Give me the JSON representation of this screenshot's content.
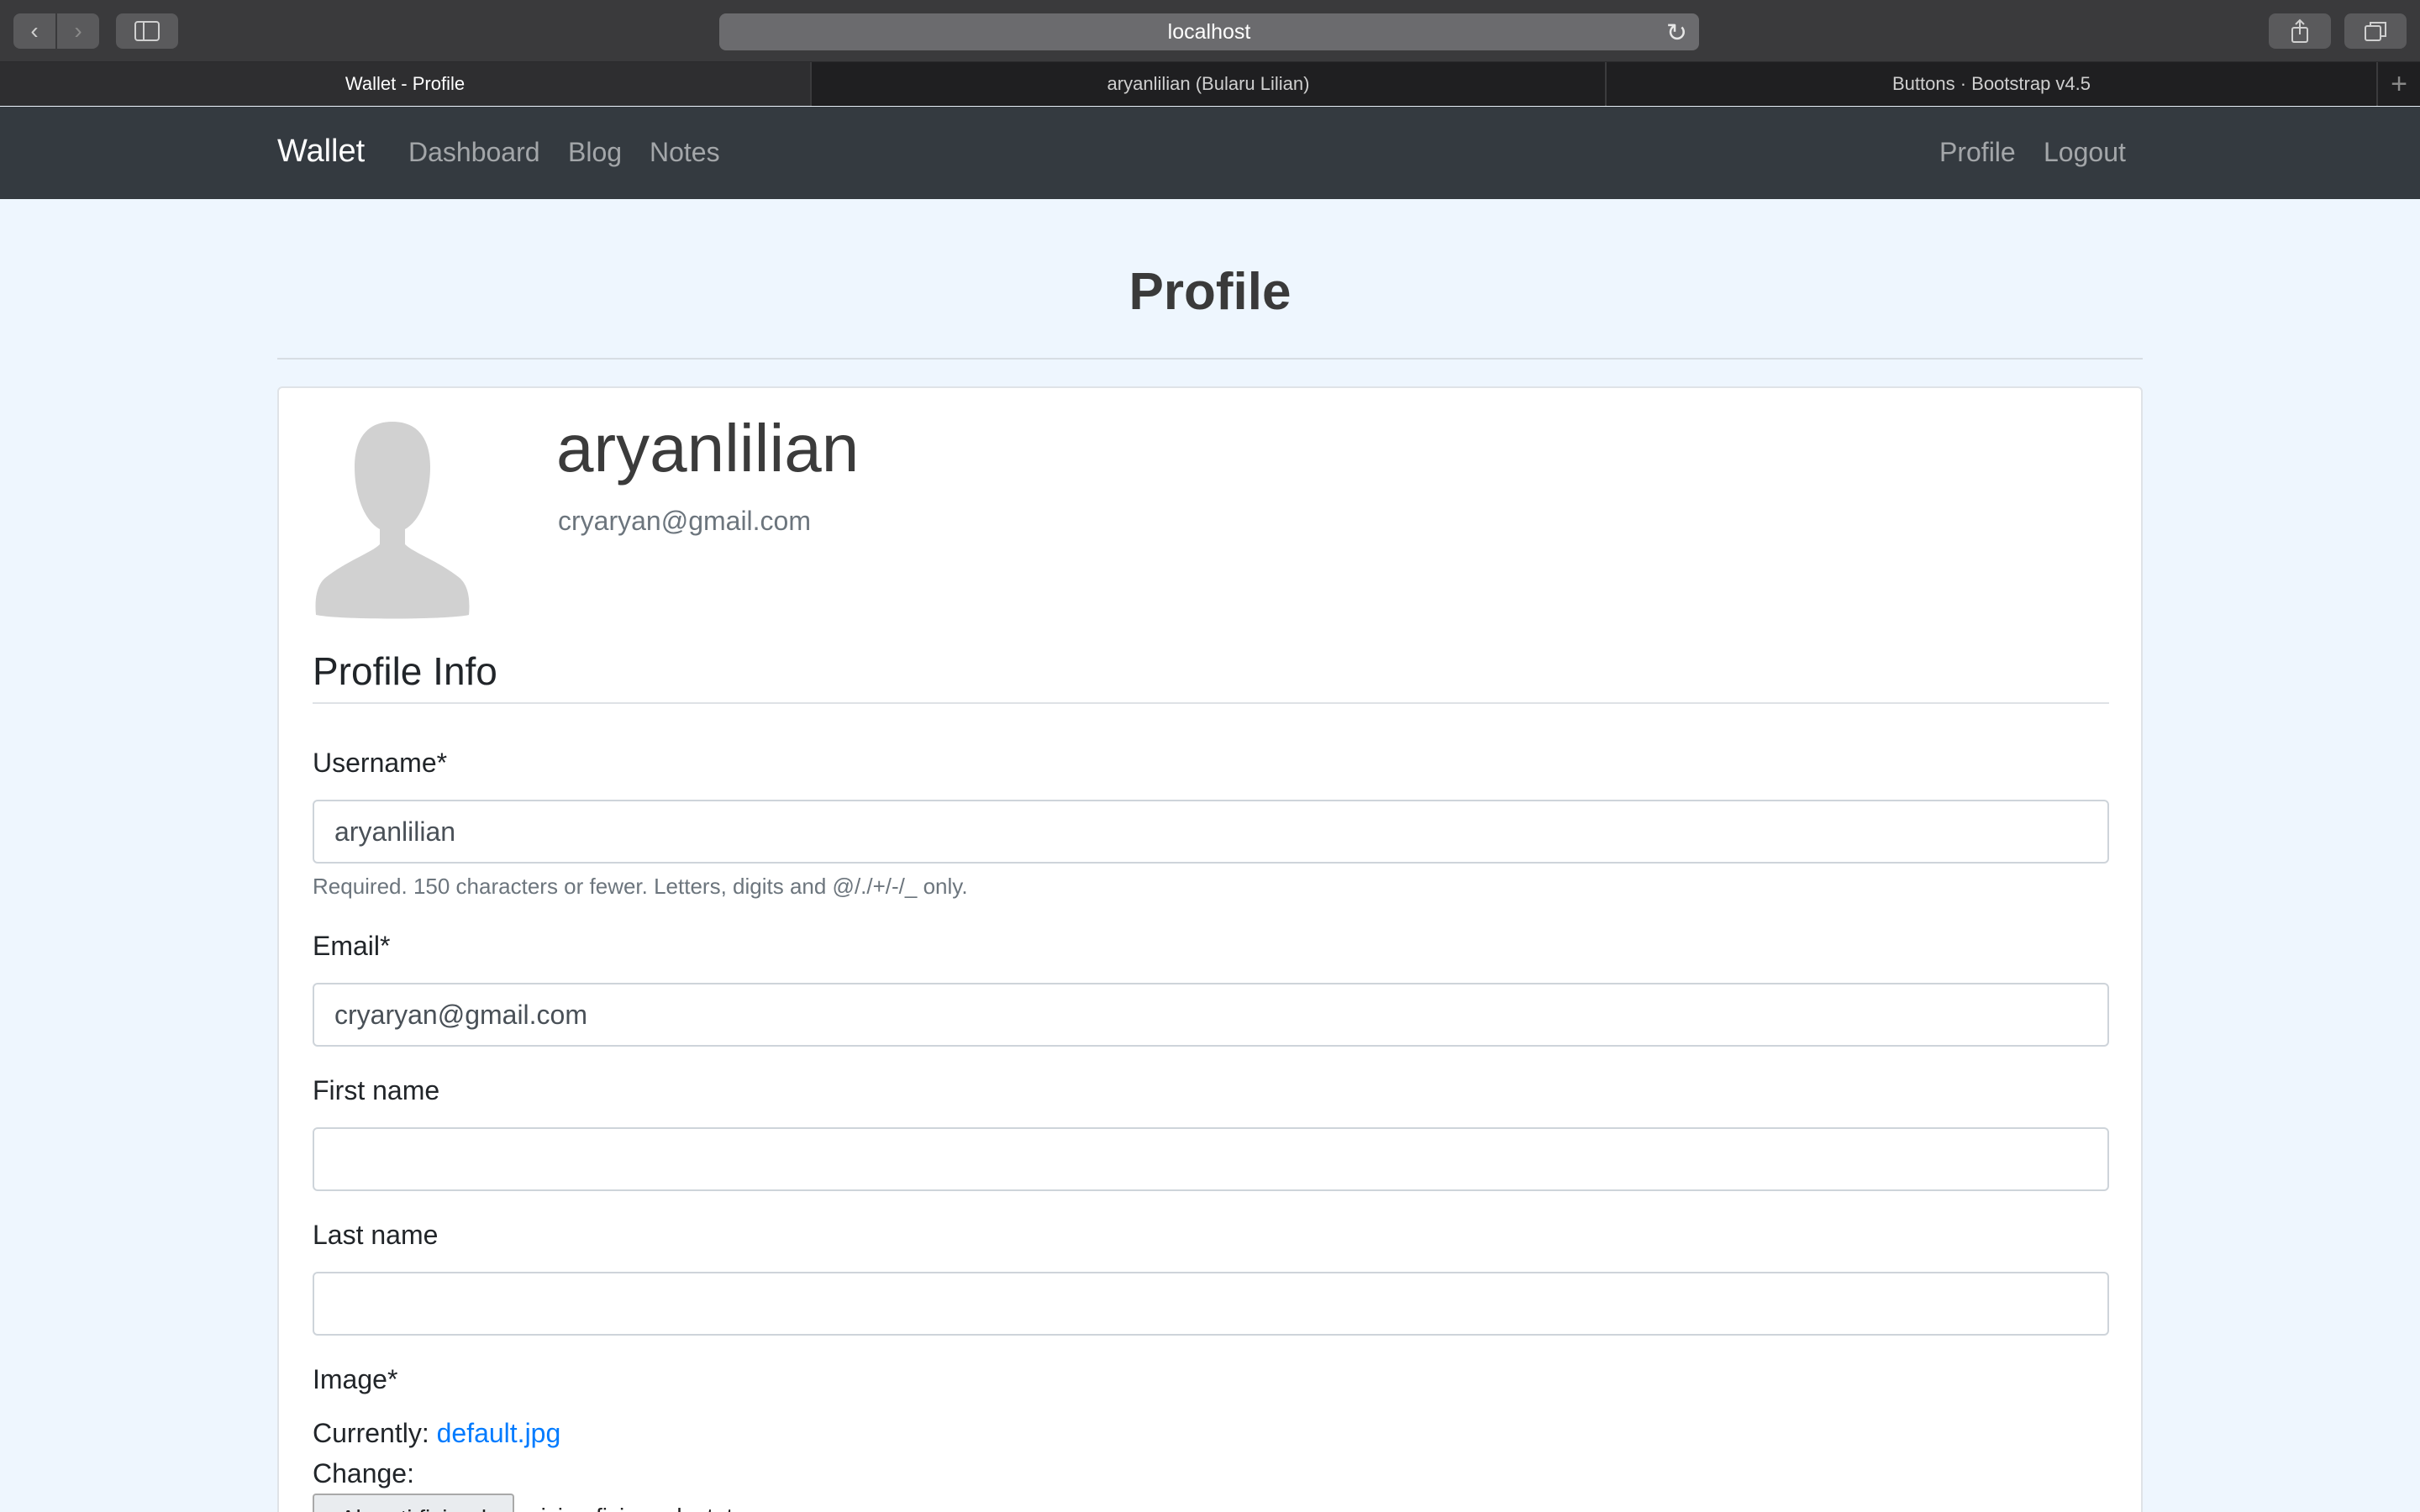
{
  "browser": {
    "url": "localhost",
    "tabs": [
      {
        "label": "Wallet - Profile",
        "active": true
      },
      {
        "label": "aryanlilian (Bularu Lilian)",
        "active": false
      },
      {
        "label": "Buttons · Bootstrap v4.5",
        "active": false
      }
    ],
    "icons": {
      "back": "chevron-left-icon",
      "forward": "chevron-right-icon",
      "sidebar": "sidebar-icon",
      "reload": "reload-icon",
      "share": "share-icon",
      "tabs": "tab-overview-icon",
      "new_tab": "plus-icon"
    }
  },
  "navbar": {
    "brand": "Wallet",
    "links": [
      "Dashboard",
      "Blog",
      "Notes"
    ],
    "right_links": [
      "Profile",
      "Logout"
    ]
  },
  "page": {
    "title": "Profile"
  },
  "profile": {
    "username": "aryanlilian",
    "email": "cryaryan@gmail.com"
  },
  "form": {
    "section_title": "Profile Info",
    "username": {
      "label": "Username*",
      "value": "aryanlilian",
      "help": "Required. 150 characters or fewer. Letters, digits and @/./+/-/_ only."
    },
    "email": {
      "label": "Email*",
      "value": "cryaryan@gmail.com"
    },
    "first_name": {
      "label": "First name",
      "value": ""
    },
    "last_name": {
      "label": "Last name",
      "value": ""
    },
    "image": {
      "label": "Image*",
      "currently_label": "Currently:",
      "current_file": "default.jpg",
      "change_label": "Change:",
      "choose_button": "Alegeți fișierul",
      "no_file": "niciun fișier selectat"
    }
  },
  "colors": {
    "navbar_bg": "#343a40",
    "page_bg": "#eef6fe",
    "link": "#007bff"
  }
}
